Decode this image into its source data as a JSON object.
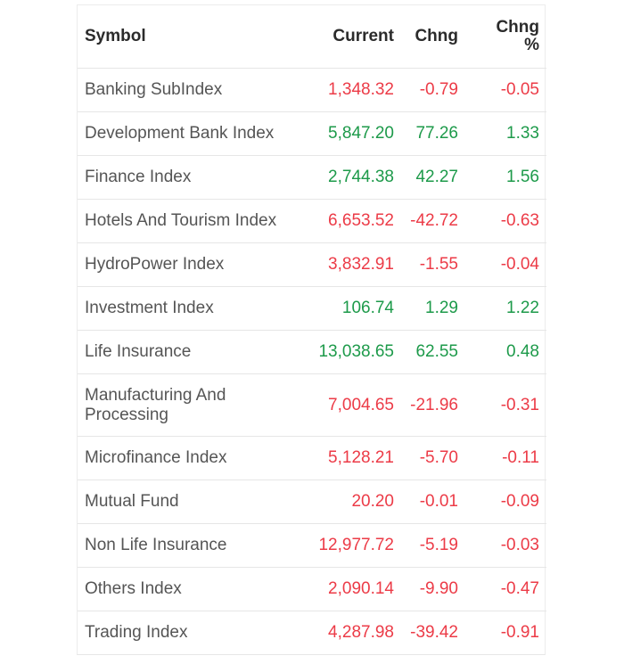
{
  "table": {
    "headers": {
      "symbol": "Symbol",
      "current": "Current",
      "change": "Chng",
      "change_pct_line1": "Chng",
      "change_pct_line2": "%"
    },
    "colors": {
      "positive": "#1d9a4a",
      "negative": "#ec3b47",
      "symbol_text": "#555555",
      "header_text": "#2b2b2b"
    },
    "rows": [
      {
        "symbol": "Banking SubIndex",
        "current": "1,348.32",
        "change": "-0.79",
        "change_pct": "-0.05",
        "direction": "down"
      },
      {
        "symbol": "Development Bank Index",
        "current": "5,847.20",
        "change": "77.26",
        "change_pct": "1.33",
        "direction": "up"
      },
      {
        "symbol": "Finance Index",
        "current": "2,744.38",
        "change": "42.27",
        "change_pct": "1.56",
        "direction": "up"
      },
      {
        "symbol": "Hotels And Tourism Index",
        "current": "6,653.52",
        "change": "-42.72",
        "change_pct": "-0.63",
        "direction": "down"
      },
      {
        "symbol": "HydroPower Index",
        "current": "3,832.91",
        "change": "-1.55",
        "change_pct": "-0.04",
        "direction": "down"
      },
      {
        "symbol": "Investment Index",
        "current": "106.74",
        "change": "1.29",
        "change_pct": "1.22",
        "direction": "up"
      },
      {
        "symbol": "Life Insurance",
        "current": "13,038.65",
        "change": "62.55",
        "change_pct": "0.48",
        "direction": "up"
      },
      {
        "symbol": "Manufacturing And Processing",
        "current": "7,004.65",
        "change": "-21.96",
        "change_pct": "-0.31",
        "direction": "down"
      },
      {
        "symbol": "Microfinance Index",
        "current": "5,128.21",
        "change": "-5.70",
        "change_pct": "-0.11",
        "direction": "down"
      },
      {
        "symbol": "Mutual Fund",
        "current": "20.20",
        "change": "-0.01",
        "change_pct": "-0.09",
        "direction": "down"
      },
      {
        "symbol": "Non Life Insurance",
        "current": "12,977.72",
        "change": "-5.19",
        "change_pct": "-0.03",
        "direction": "down"
      },
      {
        "symbol": "Others Index",
        "current": "2,090.14",
        "change": "-9.90",
        "change_pct": "-0.47",
        "direction": "down"
      },
      {
        "symbol": "Trading Index",
        "current": "4,287.98",
        "change": "-39.42",
        "change_pct": "-0.91",
        "direction": "down"
      }
    ]
  }
}
